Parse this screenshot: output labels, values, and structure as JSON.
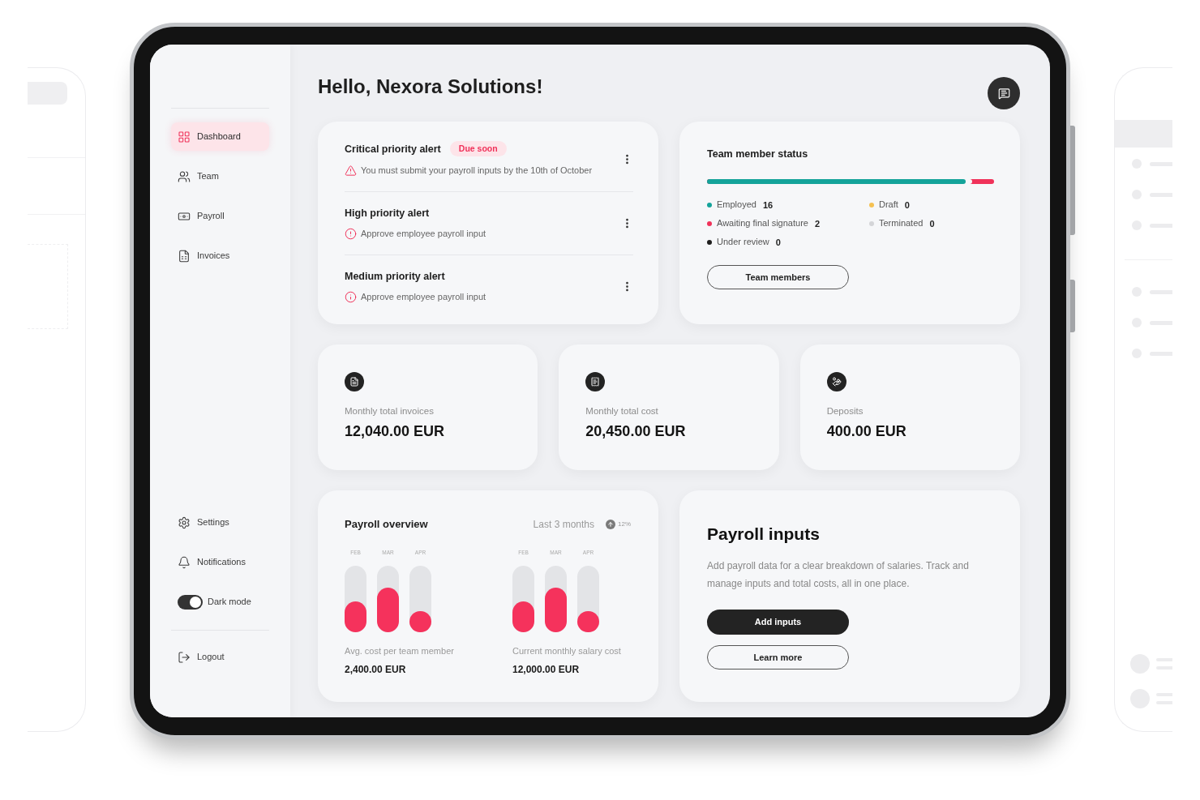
{
  "sidebar": {
    "nav_items": [
      {
        "label": "Dashboard",
        "selected": true
      },
      {
        "label": "Team",
        "selected": false
      },
      {
        "label": "Payroll",
        "selected": false
      },
      {
        "label": "Invoices",
        "selected": false
      }
    ],
    "bottom_items": [
      {
        "kind": "link",
        "label": "Settings"
      },
      {
        "kind": "link",
        "label": "Notifications"
      },
      {
        "kind": "toggle",
        "label": "Dark mode",
        "on": true
      }
    ],
    "logout": {
      "label": "Logout"
    }
  },
  "header": {
    "greeting": "Hello, Nexora Solutions!"
  },
  "alerts": [
    {
      "kind": "critical",
      "title": "Critical priority alert",
      "badge": "Due soon",
      "message": "You must submit your payroll inputs by the 10th of October"
    },
    {
      "kind": "high",
      "title": "High priority alert",
      "message": "Approve employee payroll input"
    },
    {
      "kind": "medium",
      "title": "Medium priority alert",
      "message": "Approve employee payroll input"
    }
  ],
  "team_status": {
    "title": "Team member status",
    "bar": {
      "level": 0.9
    },
    "statuses": [
      {
        "label": "Employed",
        "count": "16",
        "color": "#14a39a"
      },
      {
        "label": "Awaiting final signature",
        "count": "2",
        "color": "#f0325a"
      },
      {
        "label": "Under review",
        "count": "0",
        "color": "#1e1e1e"
      },
      {
        "label": "Draft",
        "count": "0",
        "color": "#f5c152"
      },
      {
        "label": "Terminated",
        "count": "0",
        "color": "#d4d5d8"
      }
    ],
    "button": "Team members"
  },
  "stats": [
    {
      "label": "Monthly total invoices",
      "value": "12,040.00 EUR"
    },
    {
      "label": "Monthly total cost",
      "value": "20,450.00 EUR"
    },
    {
      "label": "Deposits",
      "value": "400.00 EUR"
    }
  ],
  "payroll_overview": {
    "title": "Payroll overview",
    "period": "Last 3 months",
    "trend": "12%",
    "charts": [
      {
        "bars": [
          {
            "month": "FEB",
            "level": 0.46
          },
          {
            "month": "MAR",
            "level": 0.67
          },
          {
            "month": "APR",
            "level": 0.32
          }
        ],
        "caption": "Avg. cost per team member",
        "value": "2,400.00 EUR"
      },
      {
        "bars": [
          {
            "month": "FEB",
            "level": 0.46
          },
          {
            "month": "MAR",
            "level": 0.67
          },
          {
            "month": "APR",
            "level": 0.32
          }
        ],
        "caption": "Current monthly salary cost",
        "value": "12,000.00 EUR"
      }
    ]
  },
  "payroll_inputs": {
    "title": "Payroll inputs",
    "description": "Add payroll data for a clear breakdown of salaries. Track and manage inputs and total costs, all in one place.",
    "buttons": [
      {
        "kind": "primary",
        "label": "Add inputs"
      },
      {
        "kind": "secondary",
        "label": "Learn more"
      }
    ]
  }
}
